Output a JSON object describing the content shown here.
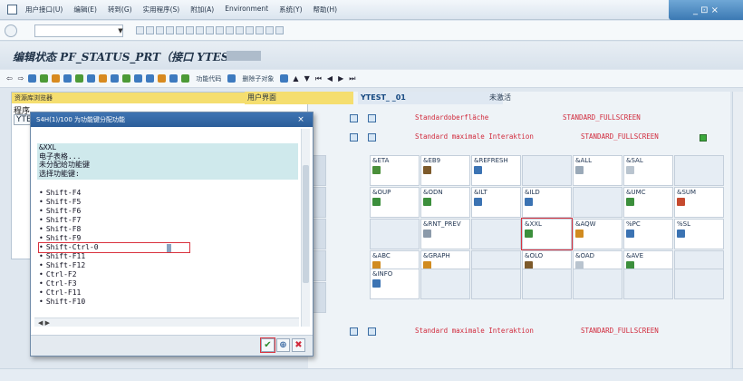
{
  "menubar": {
    "items": [
      "用户接口(U)",
      "编辑(E)",
      "转到(G)",
      "实用程序(S)",
      "附加(A)",
      "Environment",
      "系统(Y)",
      "帮助(H)"
    ],
    "window_controls": "_ ⊡ ×"
  },
  "toolbar": {
    "command_field_value": "",
    "dropdown": "▼"
  },
  "screen": {
    "title": "编辑状态 PF_STATUS_PRT（接口 YTEST",
    "app_toolbar": {
      "function_code_button": "功能代码",
      "other_button": "删除子对象"
    }
  },
  "left_pane": {
    "header": "资源库浏览器",
    "type_label": "程序",
    "name_value": "YTE"
  },
  "main": {
    "user_interface_label": "用户界面",
    "program_name": "YTEST_ _01",
    "status": "未激活",
    "row1": {
      "text": "Standardoberfläche",
      "mode": "STANDARD_FULLSCREEN"
    },
    "row2": {
      "text": "Standard maximale Interaktion",
      "mode": "STANDARD_FULLSCREEN"
    },
    "row_bottom": {
      "text": "Standard maximale Interaktion",
      "mode": "STANDARD_FULLSCREEN"
    },
    "function_keys": [
      [
        "&ETA",
        "&EB9",
        "&REFRESH",
        "",
        "&ALL",
        "&SAL",
        ""
      ],
      [
        "&OUP",
        "&ODN",
        "&ILT",
        "&ILD",
        "",
        "&UMC",
        "&SUM"
      ],
      [
        "",
        "&RNT_PREV",
        "",
        "&XXL",
        "&AQW",
        "%PC",
        "%SL"
      ],
      [
        "&ABC",
        "&GRAPH",
        "",
        "&OLO",
        "&OAD",
        "&AVE",
        ""
      ],
      [
        "&INFO",
        "",
        "",
        "",
        "",
        "",
        ""
      ]
    ]
  },
  "dialog": {
    "title": "S4H(1)/100 为功能键分配功能",
    "function_code": "&XXL",
    "info_line1": "电子表格...",
    "info_line2": "未分配给功能键",
    "info_line3": "选择功能键:",
    "keys": [
      "Shift-F4",
      "Shift-F5",
      "Shift-F6",
      "Shift-F7",
      "Shift-F8",
      "Shift-F9",
      "Shift-Ctrl-0",
      "Shift-F11",
      "Shift-F12",
      "Ctrl-F2",
      "Ctrl-F3",
      "Ctrl-F11",
      "Shift-F10"
    ],
    "selected_key": "Shift-Ctrl-0",
    "buttons": {
      "ok": "✔",
      "find": "⊕",
      "cancel": "✖"
    }
  }
}
